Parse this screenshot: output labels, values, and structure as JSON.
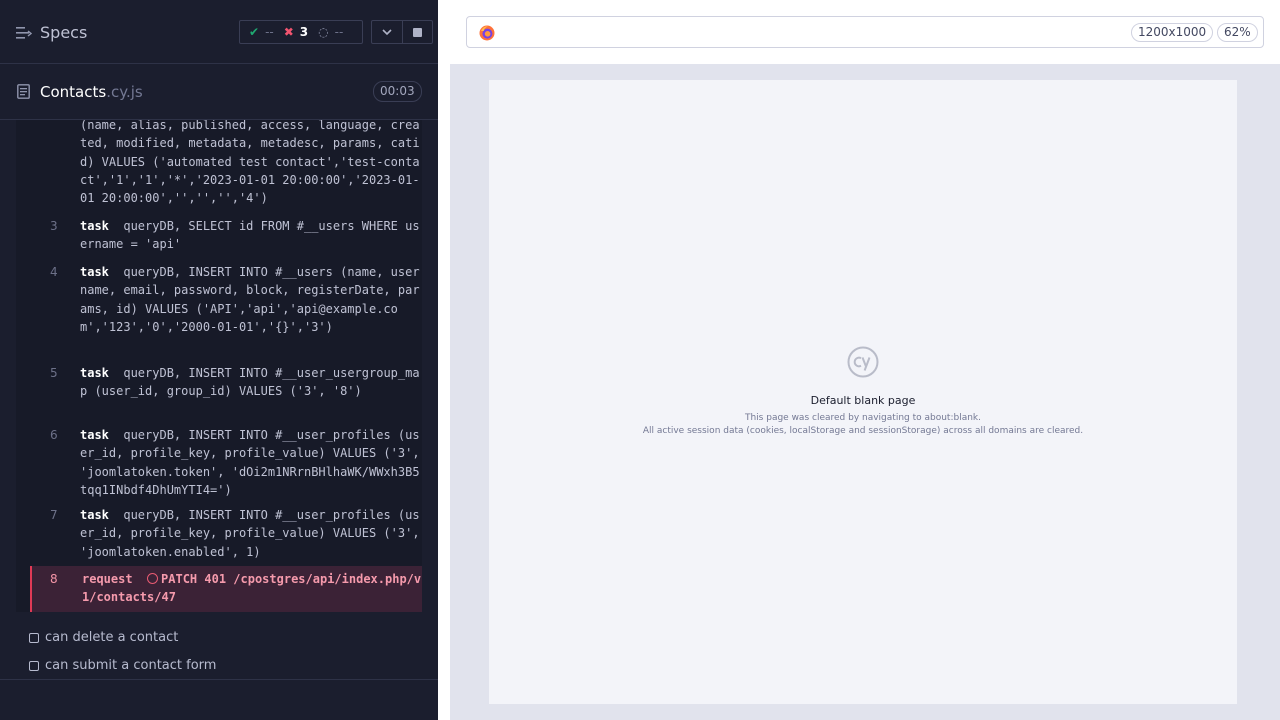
{
  "reporter": {
    "title": "Specs",
    "stats": {
      "passed": "--",
      "failed": "3",
      "pending": "--"
    },
    "file": {
      "name": "Contacts",
      "ext": ".cy.js",
      "duration": "00:03"
    },
    "commands": [
      {
        "num": "",
        "name": "",
        "text": "(name, alias, published, access, language, created, modified, metadata, metadesc, params, catid) VALUES ('automated test contact','test-contact','1','1','*','2023-01-01 20:00:00','2023-01-01 20:00:00','','','','4')",
        "failed": false
      },
      {
        "num": "3",
        "name": "task",
        "text": "queryDB, SELECT id FROM #__users WHERE username = 'api'",
        "failed": false
      },
      {
        "num": "4",
        "name": "task",
        "text": "queryDB, INSERT INTO #__users (name, username, email, password, block, registerDate, params, id) VALUES ('API','api','api@example.com','123','0','2000-01-01','{}','3')",
        "failed": false
      },
      {
        "num": "5",
        "name": "task",
        "text": "queryDB, INSERT INTO #__user_usergroup_map (user_id, group_id) VALUES ('3', '8')",
        "failed": false
      },
      {
        "num": "6",
        "name": "task",
        "text": "queryDB, INSERT INTO #__user_profiles (user_id, profile_key, profile_value) VALUES ('3', 'joomlatoken.token', 'dOi2m1NRrnBHlhaWK/WWxh3B5tqq1INbdf4DhUmYTI4=')",
        "failed": false
      },
      {
        "num": "7",
        "name": "task",
        "text": "queryDB, INSERT INTO #__user_profiles (user_id, profile_key, profile_value) VALUES ('3', 'joomlatoken.enabled', 1)",
        "failed": false
      },
      {
        "num": "8",
        "name": "request",
        "text": "PATCH 401 /cpostgres/api/index.php/v1/contacts/47",
        "failed": true
      }
    ],
    "tests": [
      {
        "label": "can delete a contact"
      },
      {
        "label": "can submit a contact form"
      }
    ]
  },
  "preview": {
    "viewport": "1200x1000",
    "zoom": "62%",
    "blank_title": "Default blank page",
    "blank_line1": "This page was cleared by navigating to about:blank.",
    "blank_line2": "All active session data (cookies, localStorage and sessionStorage) across all domains are cleared."
  },
  "colors": {
    "fail": "#f1546f",
    "pass": "#1fa971",
    "panel": "#1b1e2e"
  }
}
